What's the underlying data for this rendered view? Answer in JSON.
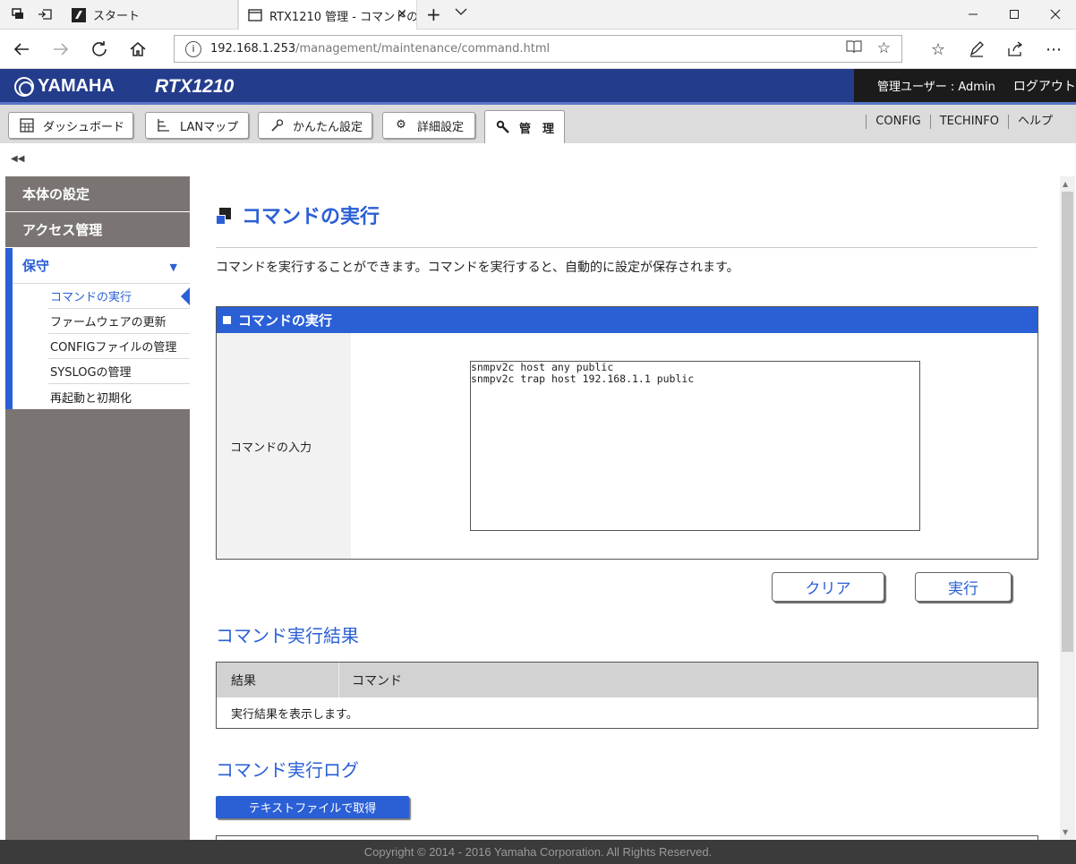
{
  "browser": {
    "tabs": [
      {
        "label": "スタート"
      },
      {
        "label": "RTX1210 管理 - コマンドの"
      }
    ],
    "url_host": "192.168.1.253",
    "url_path": "/management/maintenance/command.html"
  },
  "header": {
    "brand": "YAMAHA",
    "model": "RTX1210",
    "user_label": "管理ユーザー : Admin",
    "logout": "ログアウト"
  },
  "menu": {
    "items": [
      {
        "label": "ダッシュボード",
        "icon": "grid-icon"
      },
      {
        "label": "LANマップ",
        "icon": "lanmap-icon"
      },
      {
        "label": "かんたん設定",
        "icon": "wand-icon"
      },
      {
        "label": "詳細設定",
        "icon": "gear-icon"
      },
      {
        "label": "管　理",
        "icon": "wrench-icon"
      }
    ],
    "links": [
      "CONFIG",
      "TECHINFO",
      "ヘルプ"
    ]
  },
  "sidebar": {
    "sections": [
      "本体の設定",
      "アクセス管理"
    ],
    "open_section": "保守",
    "sub_items": [
      "コマンドの実行",
      "ファームウェアの更新",
      "CONFIGファイルの管理",
      "SYSLOGの管理",
      "再起動と初期化"
    ],
    "current_index": 0
  },
  "main": {
    "title": "コマンドの実行",
    "description": "コマンドを実行することができます。コマンドを実行すると、自動的に設定が保存されます。",
    "box_title": "コマンドの実行",
    "input_label": "コマンドの入力",
    "command_text": "snmpv2c host any public\nsnmpv2c trap host 192.168.1.1 public",
    "clear_button": "クリア",
    "run_button": "実行",
    "result_title": "コマンド実行結果",
    "result_headers": [
      "結果",
      "コマンド"
    ],
    "result_placeholder": "実行結果を表示します。",
    "log_title": "コマンド実行ログ",
    "log_button": "テキストファイルで取得"
  },
  "footer": {
    "copyright": "Copyright © 2014 - 2016 Yamaha Corporation. All Rights Reserved."
  },
  "colors": {
    "accent": "#2a5fd6",
    "header_bg": "#243c8c",
    "sidebar_bg": "#7a7572"
  }
}
